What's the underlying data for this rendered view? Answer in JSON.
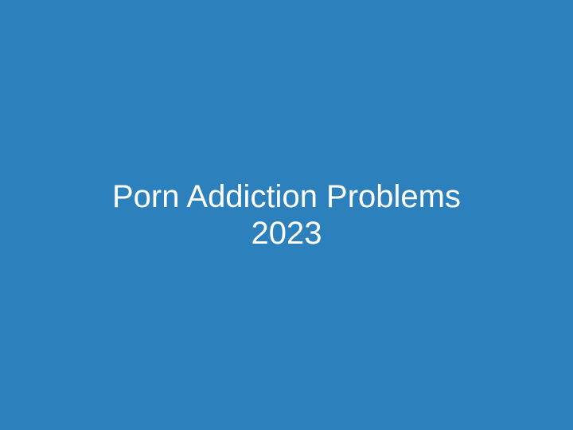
{
  "card": {
    "background_color": "#2c80bb",
    "text_color": "#ffffff",
    "title_line_1": "Porn Addiction Problems",
    "title_line_2": "2023"
  }
}
